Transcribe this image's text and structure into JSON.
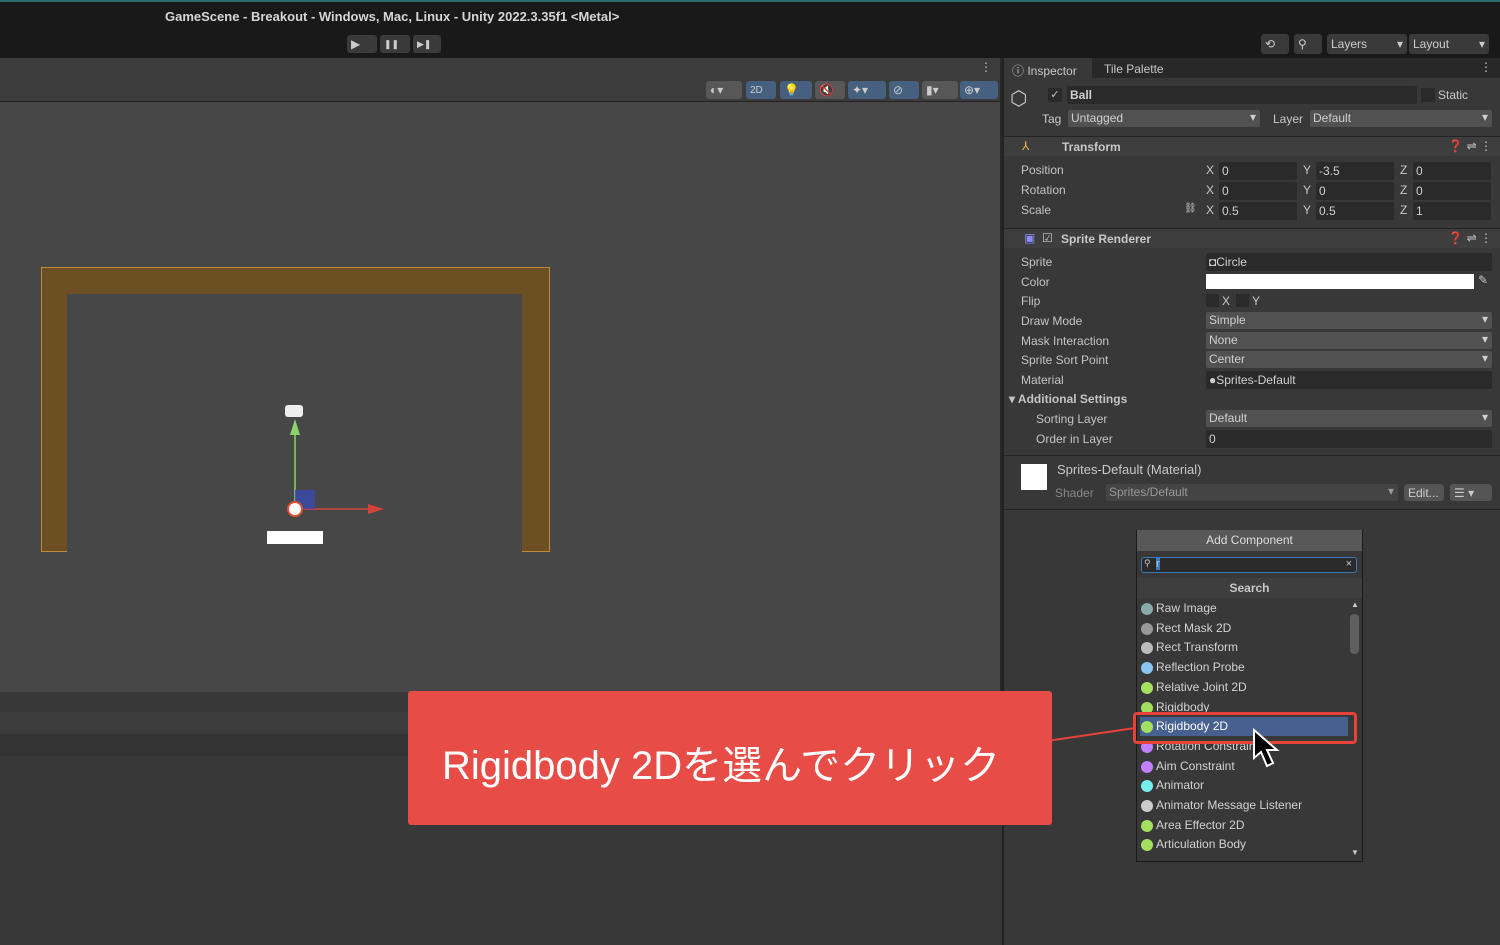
{
  "window": {
    "title": "GameScene - Breakout - Windows, Mac, Linux - Unity 2022.3.35f1 <Metal>"
  },
  "toolbar": {
    "play": "▶",
    "pause": "❚❚",
    "step": "▶❚",
    "layers": "Layers",
    "layout": "Layout"
  },
  "scene_toolbar": {
    "mode_2d": "2D"
  },
  "inspector": {
    "tabs": [
      "Inspector",
      "Tile Palette"
    ],
    "object_name": "Ball",
    "static_label": "Static",
    "tag_label": "Tag",
    "tag": "Untagged",
    "layer_label": "Layer",
    "layer": "Default",
    "transform": {
      "title": "Transform",
      "rows": [
        {
          "label": "Position",
          "x": "0",
          "y": "-3.5",
          "z": "0"
        },
        {
          "label": "Rotation",
          "x": "0",
          "y": "0",
          "z": "0"
        },
        {
          "label": "Scale",
          "x": "0.5",
          "y": "0.5",
          "z": "1"
        }
      ]
    },
    "sprite_renderer": {
      "title": "Sprite Renderer",
      "sprite_label": "Sprite",
      "sprite": "Circle",
      "color_label": "Color",
      "color": "#ffffff",
      "flip_label": "Flip",
      "flip_x": "X",
      "flip_y": "Y",
      "draw_mode_label": "Draw Mode",
      "draw_mode": "Simple",
      "mask_label": "Mask Interaction",
      "mask": "None",
      "sort_point_label": "Sprite Sort Point",
      "sort_point": "Center",
      "material_label": "Material",
      "material": "Sprites-Default",
      "additional": "Additional Settings",
      "sorting_layer_label": "Sorting Layer",
      "sorting_layer": "Default",
      "order_label": "Order in Layer",
      "order": "0"
    },
    "material": {
      "title": "Sprites-Default (Material)",
      "shader_label": "Shader",
      "shader": "Sprites/Default",
      "edit": "Edit..."
    },
    "add_component": "Add Component"
  },
  "popup": {
    "search_value": "r",
    "header": "Search",
    "items": [
      "Raw Image",
      "Rect Mask 2D",
      "Rect Transform",
      "Reflection Probe",
      "Relative Joint 2D",
      "Rigidbody",
      "Rigidbody 2D",
      "Rotation Constraint",
      "Aim Constraint",
      "Animator",
      "Animator Message Listener",
      "Area Effector 2D",
      "Articulation Body"
    ],
    "selected": "Rigidbody 2D"
  },
  "callout": {
    "text": "Rigidbody 2Dを選んでクリック",
    "color": "#e84c47"
  }
}
